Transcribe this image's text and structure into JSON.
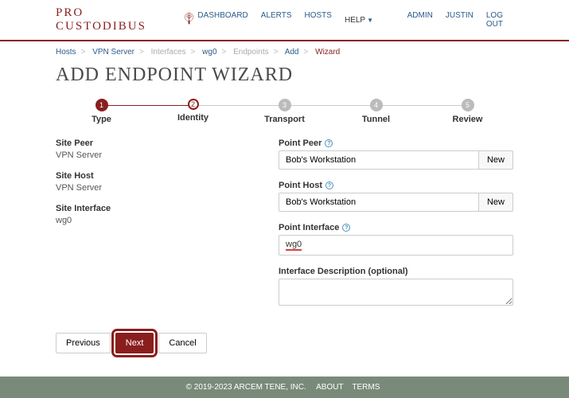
{
  "brand": "PRO CUSTODIBUS",
  "nav": {
    "dashboard": "DASHBOARD",
    "alerts": "ALERTS",
    "hosts": "HOSTS",
    "help": "HELP",
    "admin": "ADMIN",
    "user": "JUSTIN",
    "logout": "LOG OUT"
  },
  "breadcrumb": {
    "hosts": "Hosts",
    "vpn_server": "VPN Server",
    "interfaces": "Interfaces",
    "wg0": "wg0",
    "endpoints": "Endpoints",
    "add": "Add",
    "wizard": "Wizard"
  },
  "title": "ADD ENDPOINT WIZARD",
  "steps": [
    {
      "num": "1",
      "label": "Type"
    },
    {
      "num": "2",
      "label": "Identity"
    },
    {
      "num": "3",
      "label": "Transport"
    },
    {
      "num": "4",
      "label": "Tunnel"
    },
    {
      "num": "5",
      "label": "Review"
    }
  ],
  "left": {
    "site_peer_label": "Site Peer",
    "site_peer_value": "VPN Server",
    "site_host_label": "Site Host",
    "site_host_value": "VPN Server",
    "site_interface_label": "Site Interface",
    "site_interface_value": "wg0"
  },
  "right": {
    "point_peer_label": "Point Peer",
    "point_peer_value": "Bob's Workstation",
    "point_host_label": "Point Host",
    "point_host_value": "Bob's Workstation",
    "point_interface_label": "Point Interface",
    "point_interface_value": "wg0",
    "description_label": "Interface Description (optional)",
    "new_btn": "New"
  },
  "actions": {
    "previous": "Previous",
    "next": "Next",
    "cancel": "Cancel"
  },
  "footer": {
    "copyright": "© 2019-2023 ARCEM TENE, INC.",
    "about": "ABOUT",
    "terms": "TERMS"
  }
}
